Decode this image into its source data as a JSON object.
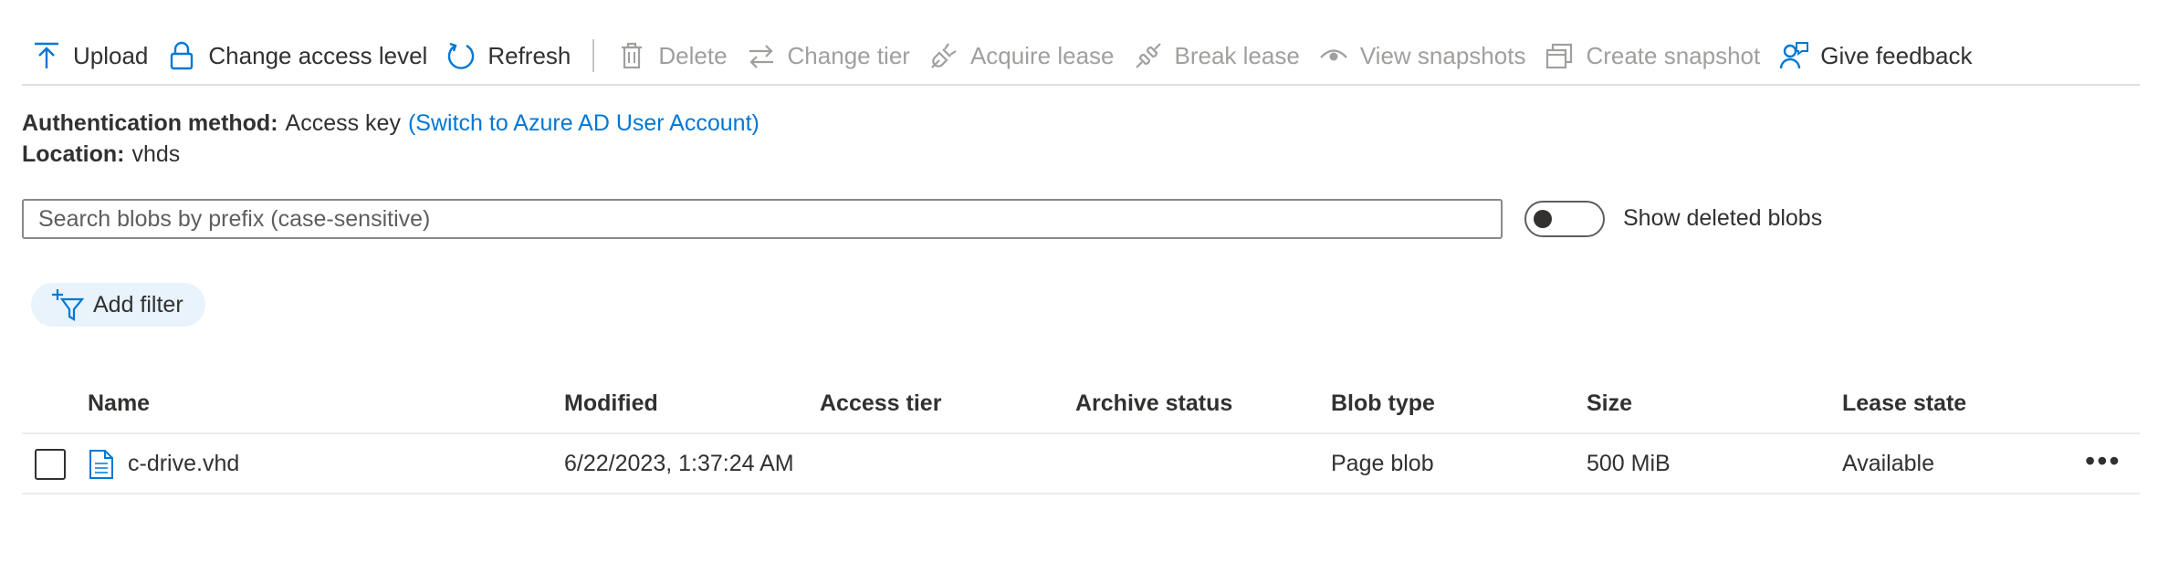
{
  "toolbar": {
    "upload": "Upload",
    "change_access": "Change access level",
    "refresh": "Refresh",
    "delete": "Delete",
    "change_tier": "Change tier",
    "acquire_lease": "Acquire lease",
    "break_lease": "Break lease",
    "view_snapshots": "View snapshots",
    "create_snapshot": "Create snapshot",
    "give_feedback": "Give feedback"
  },
  "info": {
    "auth_label": "Authentication method:",
    "auth_value": "Access key",
    "auth_link": "(Switch to Azure AD User Account)",
    "location_label": "Location:",
    "location_value": "vhds"
  },
  "search": {
    "placeholder": "Search blobs by prefix (case-sensitive)",
    "value": ""
  },
  "show_deleted": {
    "label": "Show deleted blobs",
    "enabled": false
  },
  "filter": {
    "add_label": "Add filter"
  },
  "table": {
    "columns": [
      "Name",
      "Modified",
      "Access tier",
      "Archive status",
      "Blob type",
      "Size",
      "Lease state"
    ],
    "rows": [
      {
        "name": "c-drive.vhd",
        "modified": "6/22/2023, 1:37:24 AM",
        "access_tier": "",
        "archive_status": "",
        "blob_type": "Page blob",
        "size": "500 MiB",
        "lease_state": "Available",
        "more": "•••"
      }
    ]
  },
  "colors": {
    "accent": "#0078d4",
    "text": "#323130",
    "disabled": "#a19f9d",
    "pill_bg": "#e8f3fc"
  }
}
